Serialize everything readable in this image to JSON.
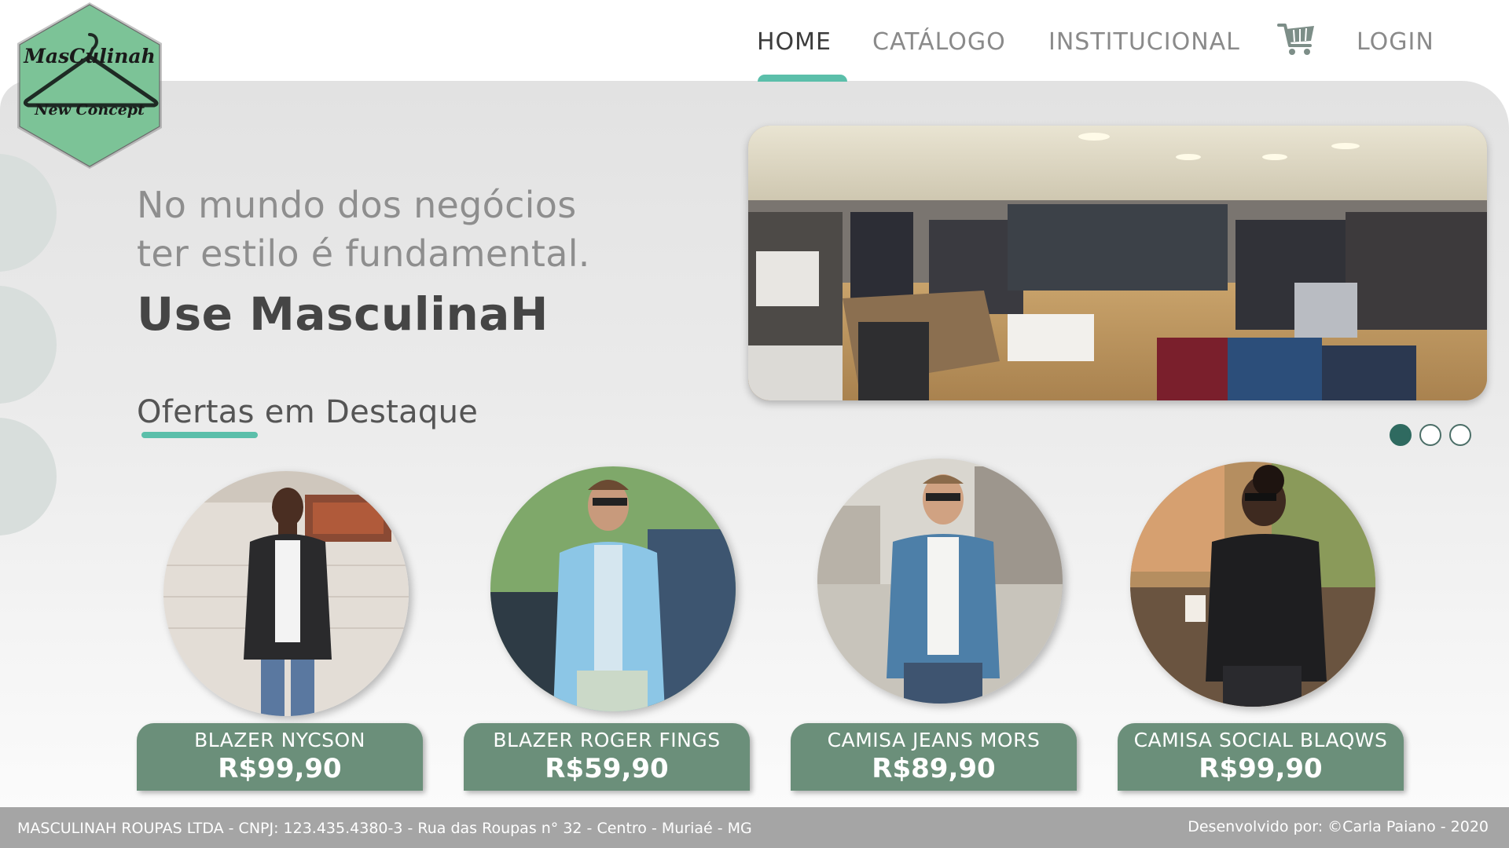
{
  "brand": {
    "logo_text_top": "MasCulinah",
    "logo_text_bottom": "New Concept",
    "logo_color": "#7cc397"
  },
  "nav": {
    "items": [
      {
        "label": "HOME",
        "active": true
      },
      {
        "label": "CATÁLOGO",
        "active": false
      },
      {
        "label": "INSTITUCIONAL",
        "active": false
      },
      {
        "label": "LOGIN",
        "active": false
      }
    ],
    "cart_icon": "shopping-cart-icon",
    "accent_color": "#5bbfaa"
  },
  "hero": {
    "tagline_line1": "No mundo dos negócios",
    "tagline_line2": "ter estilo é fundamental.",
    "headline": "Use MasculinaH"
  },
  "carousel": {
    "slides": 3,
    "active_slide": 1
  },
  "offers": {
    "title_part1": "Ofertas",
    "title_part2": " em Destaque",
    "products": [
      {
        "name": "BLAZER NYCSON",
        "price": "R$99,90"
      },
      {
        "name": "BLAZER ROGER FINGS",
        "price": "R$59,90"
      },
      {
        "name": "CAMISA JEANS MORS",
        "price": "R$89,90"
      },
      {
        "name": "CAMISA SOCIAL BLAQWS",
        "price": "R$99,90"
      }
    ],
    "card_color": "#6b8f7a"
  },
  "footer": {
    "company": "MASCULINAH ROUPAS LTDA - CNPJ: 123.435.4380-3 - Rua das Roupas n° 32 - Centro - Muriaé - MG",
    "credits": "Desenvolvido por: ©Carla Paiano - 2020"
  }
}
